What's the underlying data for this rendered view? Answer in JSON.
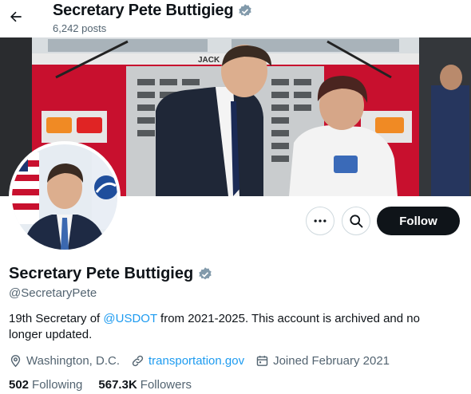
{
  "header": {
    "name": "Secretary Pete Buttigieg",
    "posts": "6,242 posts"
  },
  "banner": {
    "truck_text": "JACK"
  },
  "actions": {
    "more_icon": "more-horizontal-icon",
    "search_icon": "search-icon",
    "follow_label": "Follow"
  },
  "profile": {
    "name": "Secretary Pete Buttigieg",
    "handle": "@SecretaryPete",
    "bio_before": "19th Secretary of ",
    "bio_mention": "@USDOT",
    "bio_after": " from 2021-2025. This account is archived and no longer updated.",
    "location": "Washington, D.C.",
    "website": "transportation.gov",
    "joined": "Joined February 2021",
    "following_count": "502",
    "following_label": "Following",
    "followers_count": "567.3K",
    "followers_label": "Followers"
  },
  "colors": {
    "accent": "#1d9bf0",
    "text_primary": "#0f1419",
    "text_secondary": "#536471",
    "verified_badge": "#829aab",
    "button_dark": "#0f1419"
  }
}
